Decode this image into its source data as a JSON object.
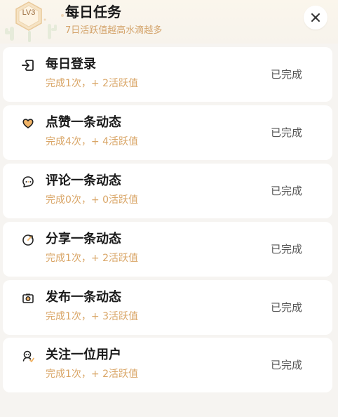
{
  "header": {
    "level_badge": "LV3",
    "title": "每日任务",
    "subtitle": "7日活跃值越高水滴越多",
    "close_icon": "close-icon"
  },
  "tasks": [
    {
      "icon": "login-icon",
      "name": "每日登录",
      "desc": "完成1次，+ 2活跃值",
      "status": "已完成"
    },
    {
      "icon": "heart-icon",
      "name": "点赞一条动态",
      "desc": "完成4次，+ 4活跃值",
      "status": "已完成"
    },
    {
      "icon": "comment-icon",
      "name": "评论一条动态",
      "desc": "完成0次，+ 0活跃值",
      "status": "已完成"
    },
    {
      "icon": "share-icon",
      "name": "分享一条动态",
      "desc": "完成1次，+ 2活跃值",
      "status": "已完成"
    },
    {
      "icon": "camera-icon",
      "name": "发布一条动态",
      "desc": "完成1次，+ 3活跃值",
      "status": "已完成"
    },
    {
      "icon": "follow-icon",
      "name": "关注一位用户",
      "desc": "完成1次，+ 2活跃值",
      "status": "已完成"
    }
  ],
  "colors": {
    "accent": "#d9a566",
    "background": "#f6f4f1",
    "card": "#ffffff"
  }
}
